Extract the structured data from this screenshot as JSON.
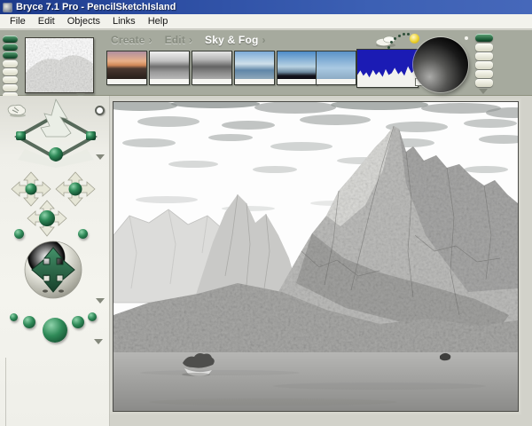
{
  "window": {
    "title": "Bryce 7.1  Pro - PencilSketchIsland",
    "app_icon": "bryce-app-icon"
  },
  "menu_bar": {
    "items": [
      "File",
      "Edit",
      "Objects",
      "Links",
      "Help"
    ]
  },
  "toolbar": {
    "tabs": [
      {
        "label": "Create",
        "state": "inactive"
      },
      {
        "label": "Edit",
        "state": "inactive"
      },
      {
        "label": "Sky & Fog",
        "state": "active"
      }
    ],
    "tab_chevron": "›",
    "sky_presets": [
      {
        "name": "sunset-sky-preset"
      },
      {
        "name": "gray-overcast-preset-a"
      },
      {
        "name": "gray-overcast-preset-b"
      },
      {
        "name": "blue-haze-preset"
      },
      {
        "name": "storm-horizon-preset"
      },
      {
        "name": "clear-blue-preset"
      },
      {
        "name": "custom-sky-histogram-preset"
      }
    ],
    "sun_controls": {
      "cloud_icon": "cloud-icon",
      "sun_icon": "sun-icon",
      "trackball_icon": "sun-position-trackball"
    }
  },
  "sidebar": {
    "icons": {
      "grab_hand": "grab-hand-icon",
      "ring": "ring-toggle-icon",
      "terrain_view": "terrain-view-control",
      "pan_cross": "camera-pan-cross",
      "camera_trackball": "camera-trackball",
      "render_spheres": "render-control-spheres",
      "flyout": "flyout-triangle-icon"
    }
  },
  "viewport": {
    "scene": "grayscale pencil-sketch mountain island render"
  },
  "colors": {
    "titlebar_blue": "#2c4da2",
    "toolbar_gray_green": "#a6aa9e",
    "panel_light": "#d2d2ca",
    "sidebar_light": "#f2f2ec",
    "accent_green": "#2f8a58",
    "sun_yellow": "#ecd12c",
    "preset_blue": "#1b1bb4",
    "menu_bg": "#f2f2ec"
  }
}
